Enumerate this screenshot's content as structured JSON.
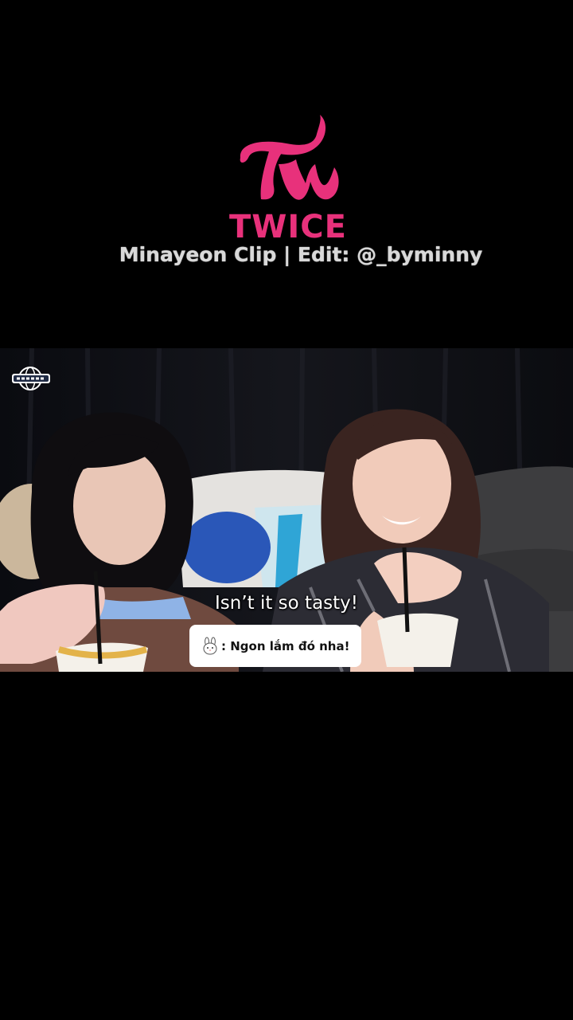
{
  "header": {
    "logo_icon": "twice-logo-icon",
    "logo_text": "TWICE",
    "credit_text": "Minayeon Clip | Edit: @_byminny",
    "brand_color": "#e8317b"
  },
  "video": {
    "channel_badge_icon": "twice-globe-badge-icon",
    "subtitle_en": "Isn’t it so tasty!",
    "subtitle_vi_icon": "bunny-icon",
    "subtitle_vi": ": Ngon lắm đó nha!"
  }
}
